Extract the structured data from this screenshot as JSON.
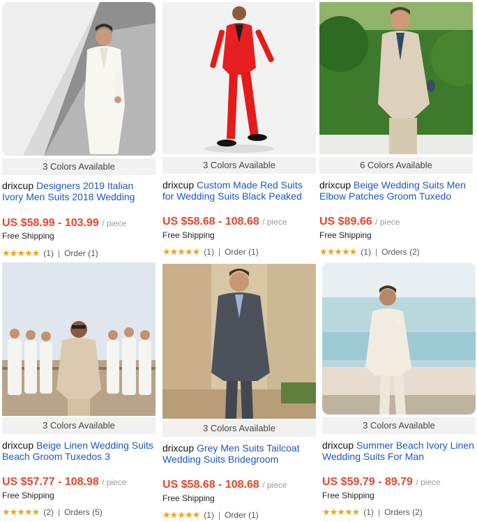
{
  "products": [
    {
      "colors_label": "3 Colors Available",
      "brand": "drixcup",
      "title": "Designers 2019 Italian Ivory Men Suits 2018 Wedding",
      "price": "US $58.99 - 103.99",
      "unit": "/ piece",
      "shipping": "Free Shipping",
      "stars": "★★★★★",
      "rating_count": "(1)",
      "orders": "Order (1)"
    },
    {
      "colors_label": "3 Colors Available",
      "brand": "drixcup",
      "title": "Custom Made Red Suits for Wedding Suits Black Peaked",
      "price": "US $58.68 - 108.68",
      "unit": "/ piece",
      "shipping": "Free Shipping",
      "stars": "★★★★★",
      "rating_count": "(1)",
      "orders": "Order (1)"
    },
    {
      "colors_label": "6 Colors Available",
      "brand": "drixcup",
      "title": "Beige Wedding Suits Men Elbow Patches Groom Tuxedo",
      "price": "US $89.66",
      "unit": "/ piece",
      "shipping": "Free Shipping",
      "stars": "★★★★★",
      "rating_count": "(1)",
      "orders": "Orders (2)"
    },
    {
      "colors_label": "3 Colors Available",
      "brand": "drixcup",
      "title": "Beige Linen Wedding Suits Beach Groom Tuxedos 3",
      "price": "US $57.77 - 108.98",
      "unit": "/ piece",
      "shipping": "Free Shipping",
      "stars": "★★★★★",
      "rating_count": "(2)",
      "orders": "Orders (5)"
    },
    {
      "colors_label": "3 Colors Available",
      "brand": "drixcup",
      "title": "Grey Men Suits Tailcoat Wedding Suits Bridegroom",
      "price": "US $58.68 - 108.68",
      "unit": "/ piece",
      "shipping": "Free Shipping",
      "stars": "★★★★★",
      "rating_count": "(1)",
      "orders": "Order (1)"
    },
    {
      "colors_label": "3 Colors Available",
      "brand": "drixcup",
      "title": "Summer Beach Ivory Linen Wedding Suits For Man",
      "price": "US $59.79 - 89.79",
      "unit": "/ piece",
      "shipping": "Free Shipping",
      "stars": "★★★★★",
      "rating_count": "(1)",
      "orders": "Orders (2)"
    }
  ],
  "colors": {
    "price": "#e8452c",
    "title_link": "#1a56c6",
    "stars": "#f6a10f"
  }
}
